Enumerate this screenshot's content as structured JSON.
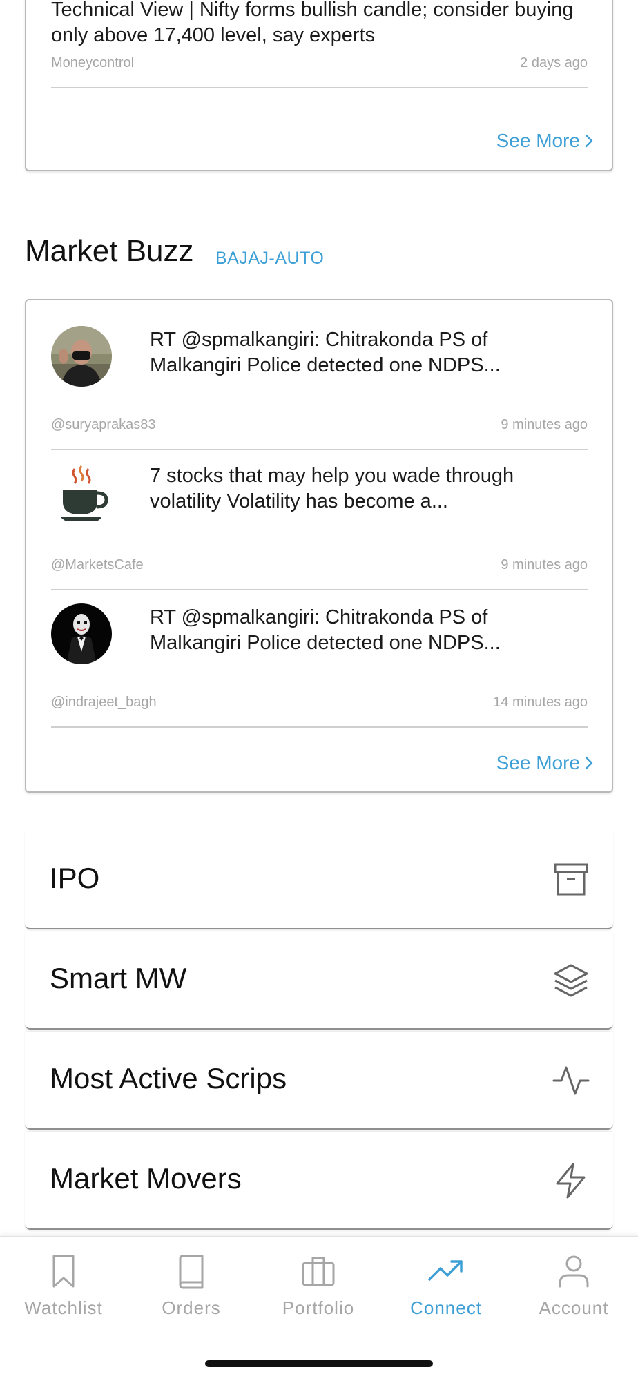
{
  "news": {
    "items": [
      {
        "title": "Technical View | Nifty forms bullish candle; consider buying only above 17,400 level, say experts",
        "source": "Moneycontrol",
        "time": "2 days ago"
      }
    ],
    "see_more": "See More"
  },
  "buzz": {
    "title": "Market Buzz",
    "tag": "BAJAJ-AUTO",
    "items": [
      {
        "text": "RT @spmalkangiri: Chitrakonda PS of Malkangiri Police detected one NDPS...",
        "handle": "@suryaprakas83",
        "time": "9 minutes ago",
        "avatar": "person-photo-avatar"
      },
      {
        "text": "7 stocks that may help you wade through volatility Volatility has become a...",
        "handle": "@MarketsCafe",
        "time": "9 minutes ago",
        "avatar": "coffee-cup-avatar"
      },
      {
        "text": "RT @spmalkangiri: Chitrakonda PS of Malkangiri Police detected one NDPS...",
        "handle": "@indrajeet_bagh",
        "time": "14 minutes ago",
        "avatar": "joker-avatar"
      }
    ],
    "see_more": "See More"
  },
  "menu": [
    {
      "label": "IPO",
      "icon": "archive-icon"
    },
    {
      "label": "Smart MW",
      "icon": "layers-icon"
    },
    {
      "label": "Most Active Scrips",
      "icon": "activity-icon"
    },
    {
      "label": "Market Movers",
      "icon": "lightning-icon"
    }
  ],
  "bottom_nav": {
    "active": "Connect",
    "items": [
      {
        "label": "Watchlist",
        "icon": "bookmark-icon"
      },
      {
        "label": "Orders",
        "icon": "book-icon"
      },
      {
        "label": "Portfolio",
        "icon": "briefcase-icon"
      },
      {
        "label": "Connect",
        "icon": "trending-up-icon"
      },
      {
        "label": "Account",
        "icon": "user-icon"
      }
    ]
  },
  "colors": {
    "accent": "#3d9fd6",
    "muted_text": "#a6a6a6",
    "border": "#b9b9b9"
  }
}
